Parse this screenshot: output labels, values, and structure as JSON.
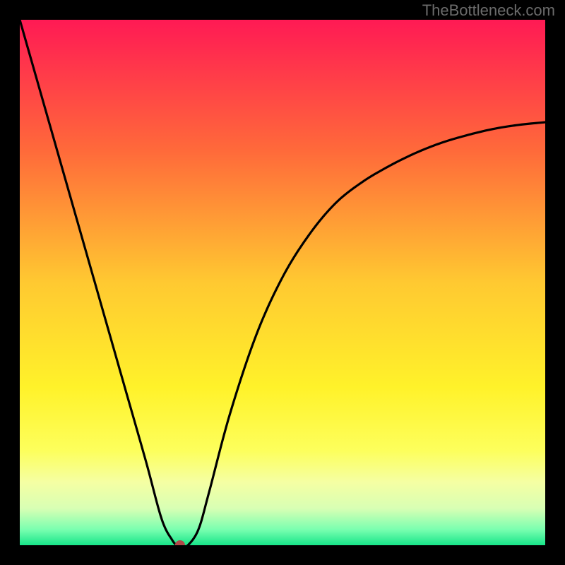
{
  "attribution": "TheBottleneck.com",
  "chart_data": {
    "type": "line",
    "title": "",
    "xlabel": "",
    "ylabel": "",
    "xlim": [
      0,
      100
    ],
    "ylim": [
      0,
      100
    ],
    "x": [
      0,
      4,
      8,
      12,
      16,
      20,
      24,
      27,
      29,
      30,
      31,
      32,
      34,
      36,
      40,
      45,
      50,
      55,
      60,
      65,
      70,
      75,
      80,
      85,
      90,
      95,
      100
    ],
    "y": [
      100,
      86,
      72,
      58,
      44,
      30,
      16,
      5,
      1,
      0,
      0,
      0,
      3,
      10,
      25,
      40,
      51,
      59,
      65,
      69,
      72,
      74.5,
      76.5,
      78,
      79.2,
      80,
      80.5
    ],
    "minimum_point": {
      "x": 30.5,
      "y": 0
    },
    "gradient_stops": [
      {
        "offset": 0.0,
        "color": "#ff1a54"
      },
      {
        "offset": 0.25,
        "color": "#ff6a3a"
      },
      {
        "offset": 0.5,
        "color": "#ffc931"
      },
      {
        "offset": 0.7,
        "color": "#fff22a"
      },
      {
        "offset": 0.82,
        "color": "#fdff5c"
      },
      {
        "offset": 0.88,
        "color": "#f5ffa3"
      },
      {
        "offset": 0.93,
        "color": "#d8ffb4"
      },
      {
        "offset": 0.97,
        "color": "#7affb0"
      },
      {
        "offset": 1.0,
        "color": "#17e589"
      }
    ],
    "colors": {
      "curve": "#000000",
      "marker": "#b04a4a",
      "background": "#000000"
    }
  }
}
